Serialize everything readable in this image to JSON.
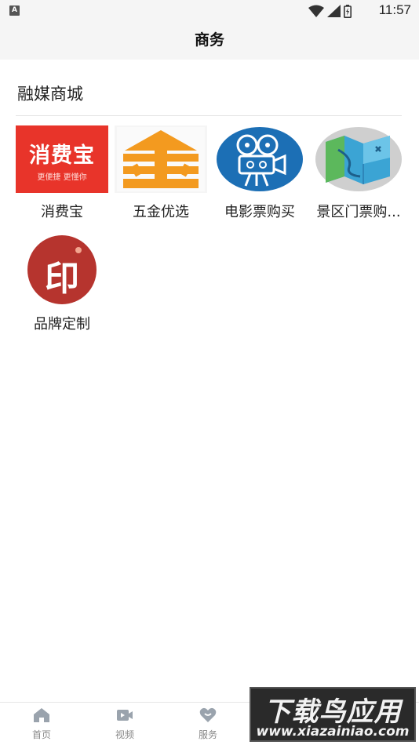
{
  "status_bar": {
    "indicator_letter": "A",
    "time": "11:57"
  },
  "header": {
    "title": "商务"
  },
  "section": {
    "title": "融媒商城",
    "items": [
      {
        "label": "消费宝",
        "logo_text": "消费宝",
        "logo_subtext": "更便捷  更懂你",
        "logo_bg": "#e8342a"
      },
      {
        "label": "五金优选",
        "logo_text": "金",
        "logo_bg": "#f39a1f"
      },
      {
        "label": "电影票购买",
        "logo_bg": "#1c6fb5"
      },
      {
        "label": "景区门票购...",
        "logo_bg": "#cfcfcf"
      },
      {
        "label": "品牌定制",
        "logo_text": "印",
        "logo_bg": "#b6342e"
      }
    ]
  },
  "tabbar": {
    "tabs": [
      {
        "label": "首页",
        "icon": "home-icon"
      },
      {
        "label": "视频",
        "icon": "video-icon"
      },
      {
        "label": "服务",
        "icon": "heart-icon"
      }
    ]
  },
  "watermark": {
    "main": "下载鸟应用",
    "url": "www.xiazainiao.com"
  }
}
